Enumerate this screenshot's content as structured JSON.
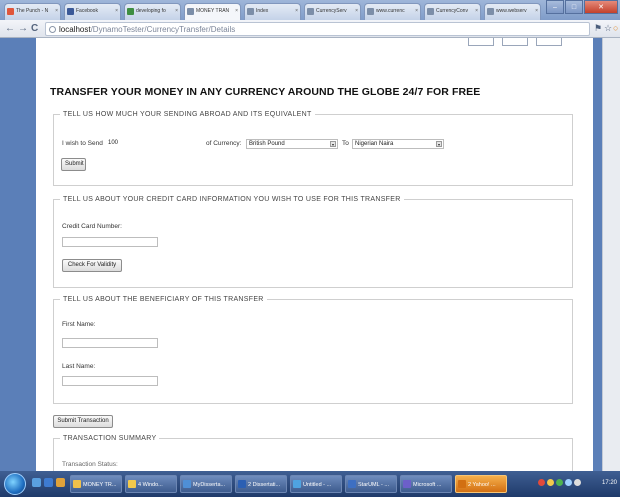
{
  "browser": {
    "tabs": [
      {
        "label": "The Punch - N",
        "color": "#e0563b"
      },
      {
        "label": "Facebook",
        "color": "#3b5998"
      },
      {
        "label": "developing fo",
        "color": "#3e8e41"
      },
      {
        "label": "MONEY TRAN",
        "color": "#7c8ea8"
      },
      {
        "label": "Index",
        "color": "#7c8ea8"
      },
      {
        "label": "CurrencyServ",
        "color": "#7c8ea8"
      },
      {
        "label": "www.currenc",
        "color": "#7c8ea8"
      },
      {
        "label": "CurrencyConv",
        "color": "#7c8ea8"
      },
      {
        "label": "www.webserv",
        "color": "#7c8ea8"
      }
    ],
    "window_controls": {
      "minimize": "–",
      "maximize": "□",
      "close": "✕"
    },
    "nav": {
      "back": "←",
      "forward": "→",
      "reload": "C"
    },
    "url_host": "localhost",
    "url_path": "/DynamoTester/CurrencyTransfer/Details",
    "toolbar_icons": [
      "flag-icon",
      "star-icon",
      "stop-icon",
      "wrench-icon"
    ]
  },
  "page": {
    "title": "TRANSFER YOUR MONEY IN ANY CURRENCY AROUND THE GLOBE 24/7 FOR FREE",
    "amount_section": {
      "legend": "TELL US HOW MUCH YOUR SENDING ABROAD AND ITS EQUIVALENT",
      "send_label": "I wish to Send",
      "send_value": "100",
      "currency_label": "of Currency:",
      "currency_value": "British Pound",
      "to_label": "To",
      "to_value": "Nigerian Naira",
      "submit_label": "Submit"
    },
    "card_section": {
      "legend": "TELL US ABOUT YOUR CREDIT CARD INFORMATION YOU WISH TO USE FOR THIS TRANSFER",
      "card_label": "Credit Card Number:",
      "card_value": "",
      "check_label": "Check For Validity"
    },
    "beneficiary_section": {
      "legend": "TELL US ABOUT THE BENEFICIARY OF THIS TRANSFER",
      "first_name_label": "First Name:",
      "first_name_value": "",
      "last_name_label": "Last Name:",
      "last_name_value": ""
    },
    "submit_transaction_label": "Submit Transaction",
    "summary_section": {
      "legend": "TRANSACTION SUMMARY",
      "status_label": "Transaction Status:"
    }
  },
  "taskbar": {
    "buttons": [
      {
        "label": "MONEY TR...",
        "color": "#f0c04a"
      },
      {
        "label": "4 Windo...",
        "color": "#f2c94c"
      },
      {
        "label": "MyDisserta...",
        "color": "#4f8fd6"
      },
      {
        "label": "2 Dissertati...",
        "color": "#2b5fb3"
      },
      {
        "label": "Untitled - ...",
        "color": "#4fa3e0"
      },
      {
        "label": "StarUML - ...",
        "color": "#3d6fc2"
      },
      {
        "label": "Microsoft ...",
        "color": "#6c5fc9"
      },
      {
        "label": "2 Yahoo! ...",
        "color": "#d26f12"
      }
    ],
    "clock": "17:20"
  }
}
